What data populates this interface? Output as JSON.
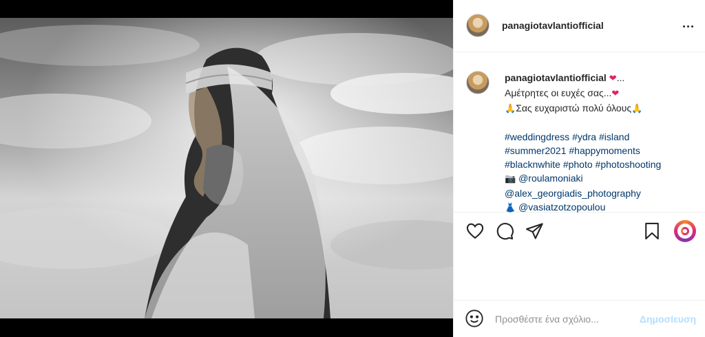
{
  "post": {
    "username": "panagiotavlantiofficial",
    "image_alt": "Black and white photo of a bride in a lace headpiece and veil against a cloudy sky"
  },
  "caption": {
    "username": "panagiotavlantiofficial",
    "title_suffix": "...",
    "line1": "Αμέτρητες οι ευχές σας...",
    "line2": "Σας ευχαριστώ πολύ όλους",
    "tags_line1": [
      "#weddingdress",
      "#ydra",
      "#island"
    ],
    "tags_line2": [
      "#summer2021",
      "#happymoments"
    ],
    "tags_line3": [
      "#blacknwhite",
      "#photo",
      "#photoshooting"
    ],
    "credit_photographer": "@roulamoniaki",
    "credit_studio": "@alex_georgiadis_photography",
    "credit_dress": "@vasiatzotzopoulou"
  },
  "icons": {
    "heart": "heart-emoji",
    "pray": "pray-emoji",
    "camera": "camera-emoji",
    "dress": "dress-emoji"
  },
  "comment": {
    "placeholder": "Προσθέστε ένα σχόλιο...",
    "post_label": "Δημοσίευση"
  },
  "colors": {
    "hashtag": "#00376b",
    "post_button_disabled": "#b2dffc",
    "heart": "#e0245e"
  }
}
